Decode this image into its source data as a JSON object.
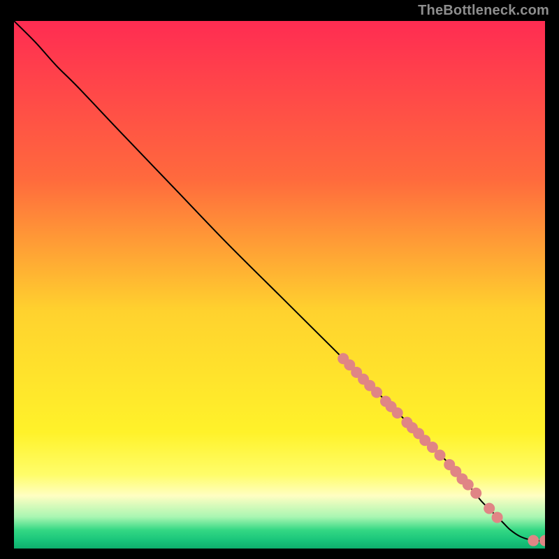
{
  "watermark": {
    "text": "TheBottleneck.com"
  },
  "chart_data": {
    "type": "line",
    "title": "",
    "xlabel": "",
    "ylabel": "",
    "xlim": [
      0,
      100
    ],
    "ylim": [
      0,
      100
    ],
    "background": {
      "type": "vertical-gradient",
      "stops": [
        {
          "offset": 0.0,
          "color": "#ff2c52"
        },
        {
          "offset": 0.3,
          "color": "#ff6a3d"
        },
        {
          "offset": 0.55,
          "color": "#ffd22e"
        },
        {
          "offset": 0.78,
          "color": "#fff22a"
        },
        {
          "offset": 0.86,
          "color": "#fffd6a"
        },
        {
          "offset": 0.9,
          "color": "#fffec2"
        },
        {
          "offset": 0.94,
          "color": "#a9f6b2"
        },
        {
          "offset": 0.965,
          "color": "#34d884"
        },
        {
          "offset": 0.985,
          "color": "#18c47a"
        },
        {
          "offset": 1.0,
          "color": "#0eae6d"
        }
      ]
    },
    "curve": {
      "x": [
        0,
        4,
        8,
        12,
        20,
        30,
        40,
        50,
        60,
        70,
        78,
        82,
        86,
        88,
        90,
        92,
        93.5,
        95.5,
        98,
        100
      ],
      "y": [
        100,
        96,
        91.5,
        87.5,
        79,
        68.5,
        58,
        48,
        38,
        28,
        20,
        16,
        11.5,
        9,
        7,
        5,
        3.5,
        2.2,
        1.5,
        1.5
      ]
    },
    "markers": {
      "color": "#e08585",
      "radius": 8,
      "points": [
        {
          "x": 62,
          "y": 36
        },
        {
          "x": 63.2,
          "y": 34.8
        },
        {
          "x": 64.5,
          "y": 33.4
        },
        {
          "x": 65.8,
          "y": 32.1
        },
        {
          "x": 67,
          "y": 30.9
        },
        {
          "x": 68.3,
          "y": 29.6
        },
        {
          "x": 70,
          "y": 27.9
        },
        {
          "x": 71,
          "y": 26.9
        },
        {
          "x": 72.2,
          "y": 25.7
        },
        {
          "x": 74,
          "y": 23.9
        },
        {
          "x": 75,
          "y": 22.9
        },
        {
          "x": 76.2,
          "y": 21.8
        },
        {
          "x": 77.4,
          "y": 20.5
        },
        {
          "x": 78.8,
          "y": 19.2
        },
        {
          "x": 80.2,
          "y": 17.7
        },
        {
          "x": 82,
          "y": 15.9
        },
        {
          "x": 83.2,
          "y": 14.6
        },
        {
          "x": 84.4,
          "y": 13.2
        },
        {
          "x": 85.5,
          "y": 12.1
        },
        {
          "x": 87,
          "y": 10.5
        },
        {
          "x": 89.5,
          "y": 7.6
        },
        {
          "x": 91,
          "y": 5.9
        },
        {
          "x": 97.8,
          "y": 1.5
        },
        {
          "x": 100,
          "y": 1.5
        }
      ]
    }
  }
}
